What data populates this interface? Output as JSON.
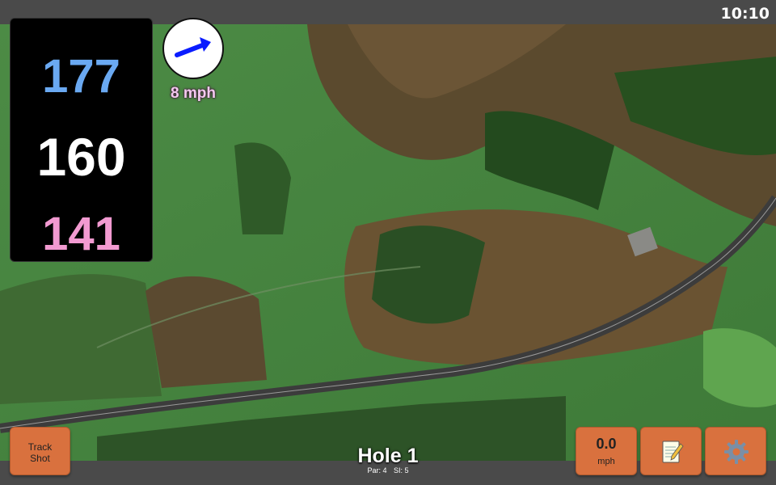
{
  "status": {
    "time": "10:10"
  },
  "distances": {
    "back": "177",
    "middle": "160",
    "front": "141"
  },
  "wind": {
    "speed": "8 mph",
    "arrow_icon": "wind-arrow-icon"
  },
  "hole": {
    "title": "Hole 1",
    "par": "Par: 4",
    "stroke_index": "SI: 5"
  },
  "buttons": {
    "track_shot_line1": "Track",
    "track_shot_line2": "Shot",
    "speed_value": "0.0",
    "speed_unit": "mph",
    "notes_icon": "notepad-icon",
    "settings_icon": "gear-icon"
  },
  "colors": {
    "back": "#6aa9f2",
    "middle": "#ffffff",
    "front": "#f29ad1",
    "button": "#d9713e",
    "wind_arrow": "#0a1cff"
  }
}
